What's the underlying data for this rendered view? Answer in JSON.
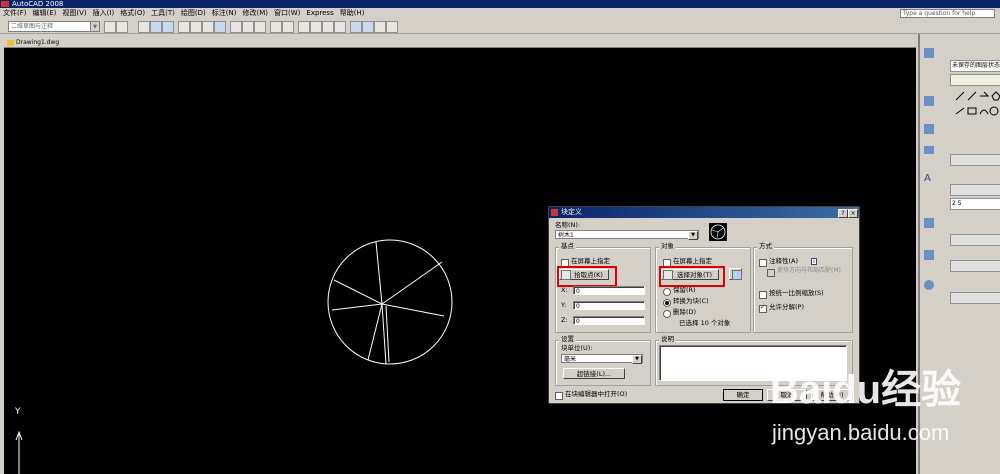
{
  "window": {
    "title": "AutoCAD 2008"
  },
  "menu": [
    "文件(F)",
    "编辑(E)",
    "视图(V)",
    "插入(I)",
    "格式(O)",
    "工具(T)",
    "绘图(D)",
    "标注(N)",
    "修改(M)",
    "窗口(W)",
    "Express",
    "帮助(H)"
  ],
  "help_search": {
    "placeholder": "Type a question for help"
  },
  "toolbar": {
    "workspace": "二维草图与注释"
  },
  "drawing": {
    "tab_title": "Drawing1.dwg",
    "ucs_y": "Y"
  },
  "right_palette": {
    "layer_state": "未保存的图层状态",
    "scale_value": "2.5"
  },
  "dialog": {
    "title": "块定义",
    "name_label": "名称(N):",
    "name_value": "树木1",
    "base_point": {
      "group": "基点",
      "specify_on_screen": "在屏幕上指定",
      "pick_button": "拾取点(K)",
      "x_label": "X:",
      "x_value": "0",
      "y_label": "Y:",
      "y_value": "0",
      "z_label": "Z:",
      "z_value": "0"
    },
    "objects": {
      "group": "对象",
      "specify_on_screen": "在屏幕上指定",
      "select_button": "选择对象(T)",
      "retain": "保留(R)",
      "convert": "转换为块(C)",
      "delete": "删除(D)",
      "selected_text": "已选择 10 个对象"
    },
    "behavior": {
      "group": "方式",
      "annotative": "注释性(A)",
      "match_orientation": "使块方向与布局匹配(M)",
      "scale_uniformly": "按统一比例缩放(S)",
      "allow_explode": "允许分解(P)"
    },
    "settings": {
      "group": "设置",
      "unit_label": "块单位(U):",
      "unit_value": "毫米",
      "hyperlink_button": "超链接(L)..."
    },
    "description": {
      "group": "说明"
    },
    "open_in_editor": "在块编辑器中打开(O)",
    "ok": "确定",
    "cancel": "取消",
    "help": "帮助(H)"
  },
  "watermark": {
    "line1": "Baidu经验",
    "line2": "jingyan.baidu.com"
  },
  "colors": {
    "titlebar": "#0a246a",
    "canvas": "#000000",
    "highlight": "#e00000",
    "chrome": "#d4d0c8"
  }
}
